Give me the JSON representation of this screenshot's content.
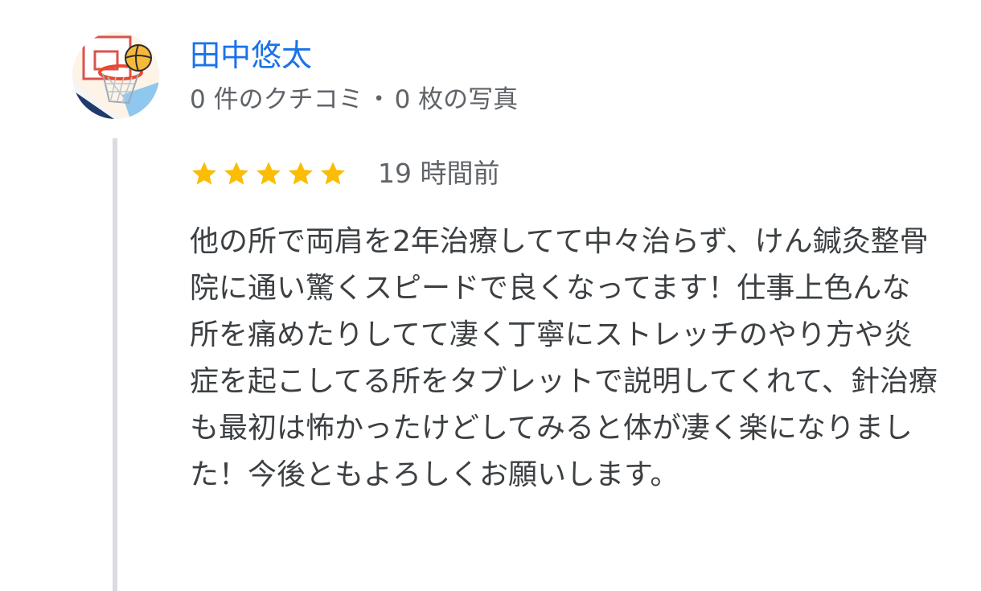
{
  "author": {
    "name": "田中悠太",
    "avatar_icon": "basketball-hoop-avatar",
    "reviews_count": "0 件のクチコミ",
    "separator": "・",
    "photos_count": "0 枚の写真"
  },
  "review": {
    "rating": 5,
    "rating_max": 5,
    "star_icon": "star-icon",
    "star_color": "#fbbc04",
    "time": "19 時間前",
    "text": "他の所で両肩を2年治療してて中々治らず、けん鍼灸整骨院に通い驚くスピードで良くなってます！仕事上色んな所を痛めたりしてて凄く丁寧にストレッチのやり方や炎症を起こしてる所をタブレットで説明してくれて、針治療も最初は怖かったけどしてみると体が凄く楽になりました！今後ともよろしくお願いします。"
  },
  "colors": {
    "author_name": "#1a73e8",
    "meta_text": "#5f6368",
    "body_text": "#3c4043",
    "thread_line": "#dadce0"
  }
}
